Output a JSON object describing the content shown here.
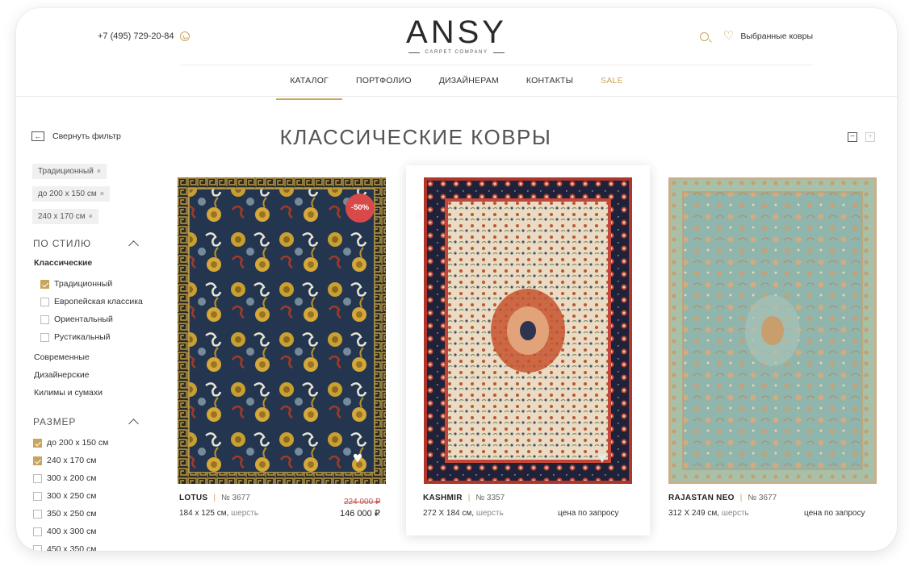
{
  "header": {
    "phone": "+7 (495) 729-20-84",
    "logo_word": "ANSY",
    "logo_sub": "CARPET COMPANY",
    "favorites_label": "Выбранные ковры"
  },
  "nav": {
    "items": [
      "КАТАЛОГ",
      "ПОРТФОЛИО",
      "ДИЗАЙНЕРАМ",
      "КОНТАКТЫ",
      "SALE"
    ],
    "active": "КАТАЛОГ"
  },
  "sidebar": {
    "collapse_label": "Свернуть фильтр",
    "chips": [
      "Традиционный",
      "до 200 х 150 см",
      "240 х 170 см"
    ],
    "style_title": "ПО СТИЛЮ",
    "style_group": "Классические",
    "style_options": [
      {
        "label": "Традиционный",
        "checked": true
      },
      {
        "label": "Европейская классика",
        "checked": false
      },
      {
        "label": "Ориентальный",
        "checked": false
      },
      {
        "label": "Рустикальный",
        "checked": false
      }
    ],
    "style_other": [
      "Современные",
      "Дизайнерские",
      "Килимы и сумахи"
    ],
    "size_title": "РАЗМЕР",
    "size_options": [
      {
        "label": "до 200 х 150 см",
        "checked": true
      },
      {
        "label": "240 х 170 см",
        "checked": true
      },
      {
        "label": "300 х 200 см",
        "checked": false
      },
      {
        "label": "300 х 250 см",
        "checked": false
      },
      {
        "label": "350 х 250 см",
        "checked": false
      },
      {
        "label": "400 х 300 см",
        "checked": false
      },
      {
        "label": "450 х 350 см",
        "checked": false
      }
    ]
  },
  "main": {
    "title": "КЛАССИЧЕСКИЕ КОВРЫ",
    "products": [
      {
        "name": "LOTUS",
        "number": "№ 3677",
        "size": "184 x 125 см,",
        "material": "шерсть",
        "old_price": "224 000 ₽",
        "price": "146 000 ₽",
        "badge": "-50%"
      },
      {
        "name": "KASHMIR",
        "number": "№ 3357",
        "size": "272 X 184 см,",
        "material": "шерсть",
        "price_request": "цена  по запросу"
      },
      {
        "name": "RAJASTAN NEO",
        "number": "№ 3677",
        "size": "312 X 249 см,",
        "material": "шерсть",
        "price_request": "цена  по запросу"
      }
    ]
  },
  "colors": {
    "accent": "#c9a45c",
    "badge": "#d84a4a",
    "old_price": "#c25450"
  }
}
